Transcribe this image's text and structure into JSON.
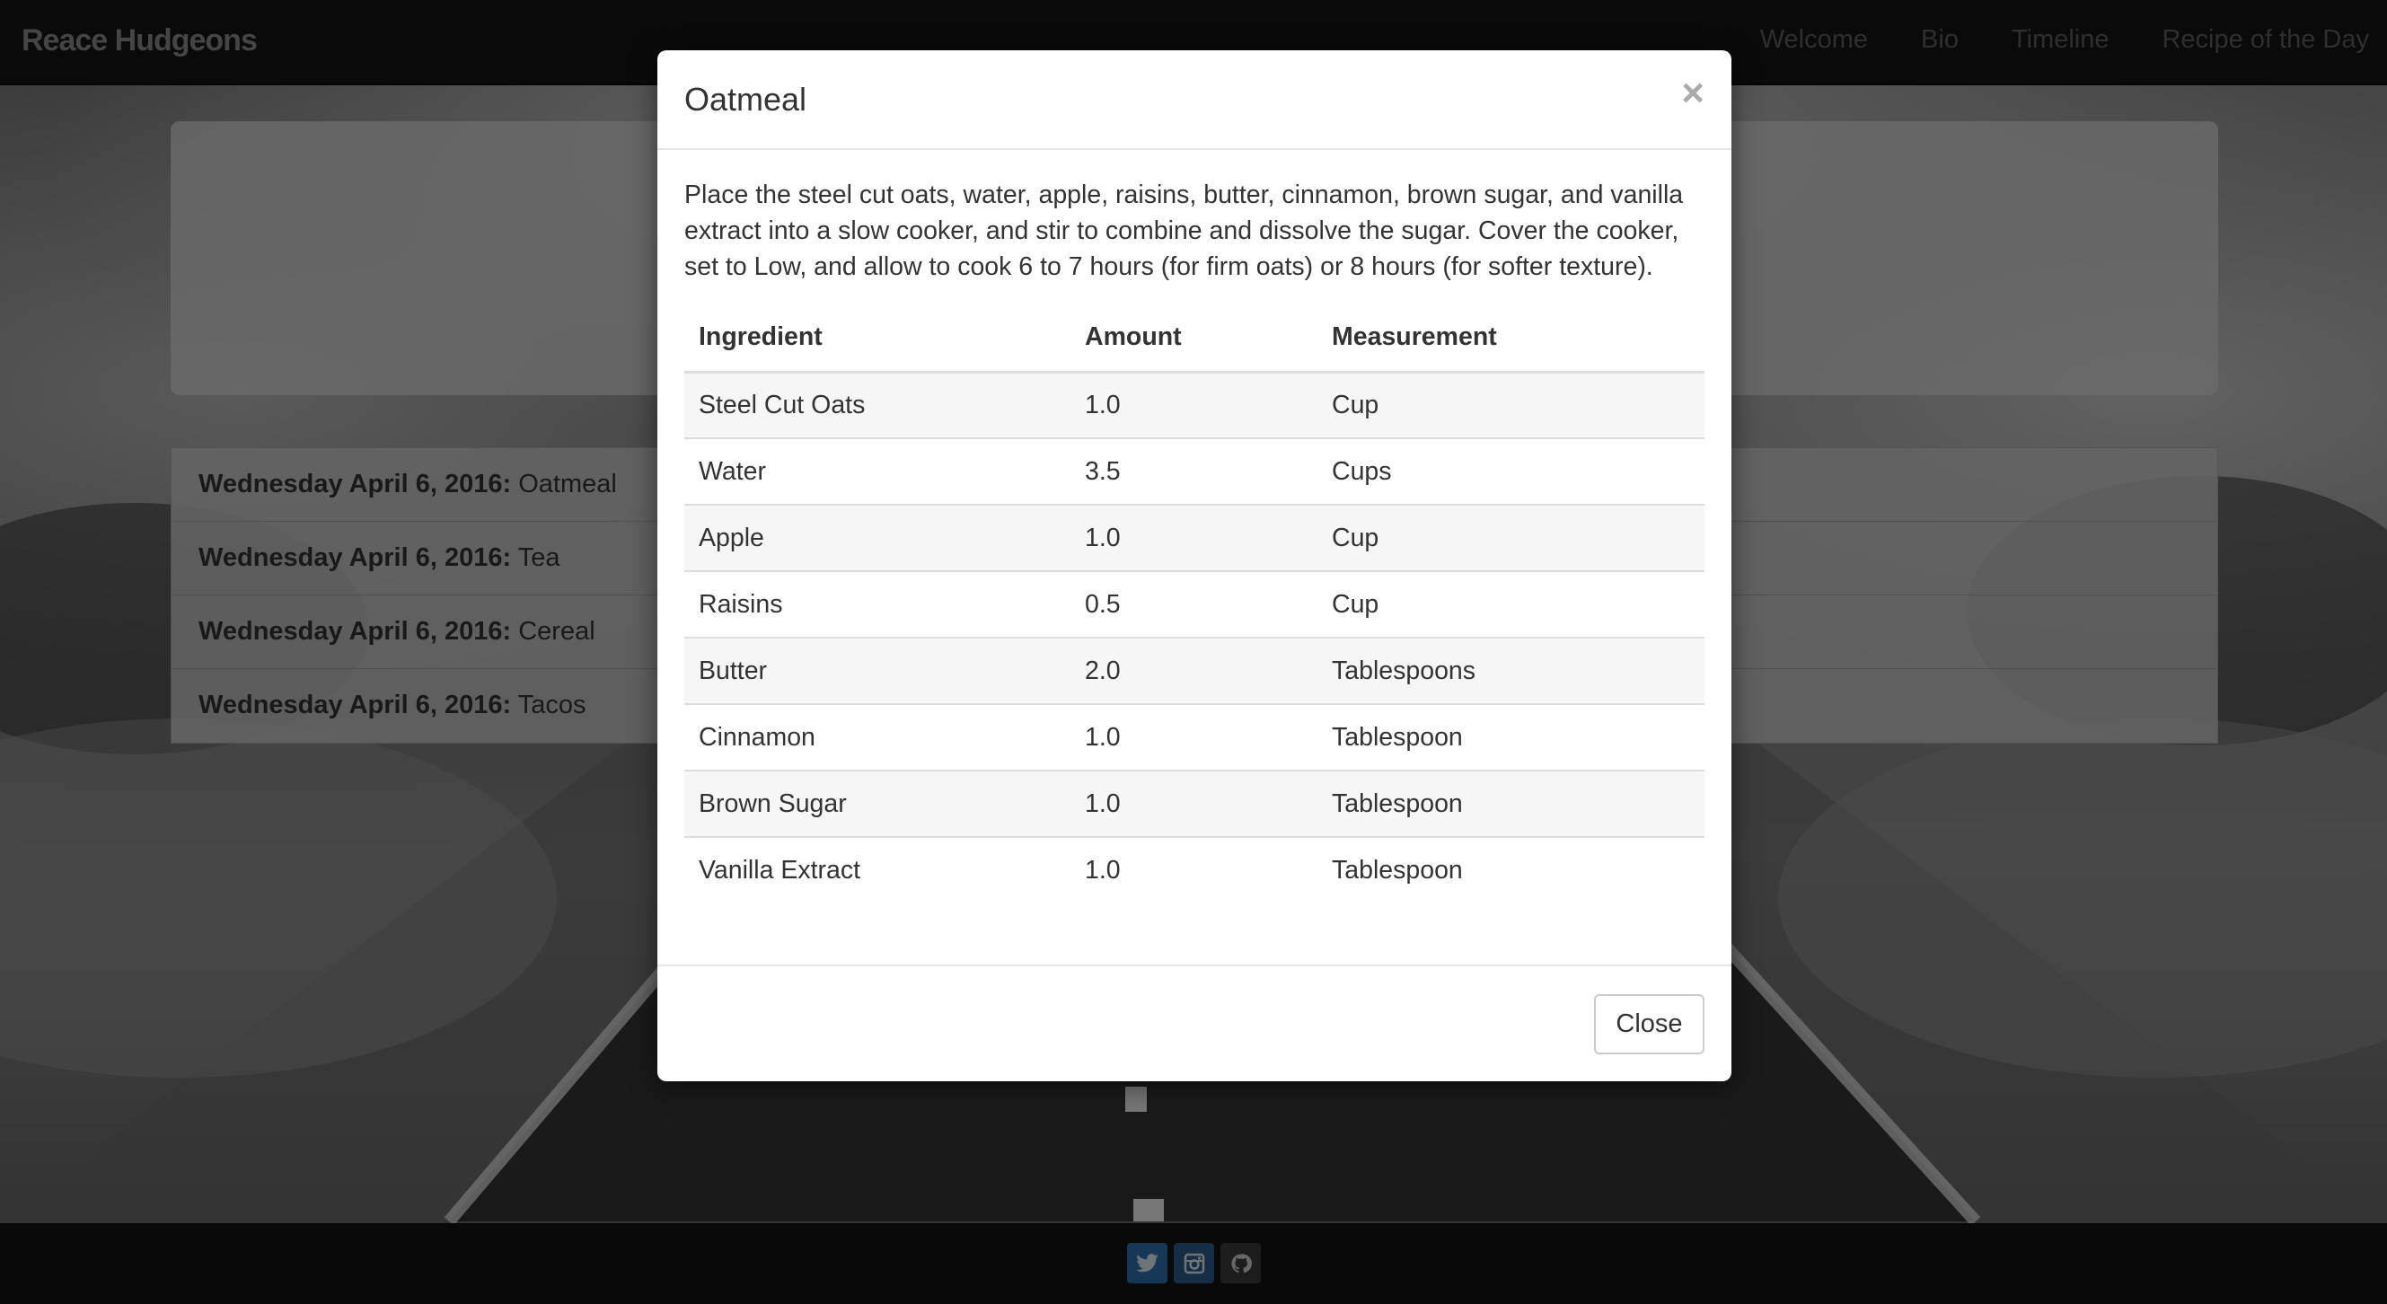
{
  "navbar": {
    "brand": "Reace Hudgeons",
    "links": [
      "Welcome",
      "Bio",
      "Timeline",
      "Recipe of the Day"
    ]
  },
  "timeline": [
    {
      "date": "Wednesday April 6, 2016:",
      "meal": "Oatmeal"
    },
    {
      "date": "Wednesday April 6, 2016:",
      "meal": "Tea"
    },
    {
      "date": "Wednesday April 6, 2016:",
      "meal": "Cereal"
    },
    {
      "date": "Wednesday April 6, 2016:",
      "meal": "Tacos"
    }
  ],
  "modal": {
    "title": "Oatmeal",
    "close_x": "×",
    "instructions": "Place the steel cut oats, water, apple, raisins, butter, cinnamon, brown sugar, and vanilla extract into a slow cooker, and stir to combine and dissolve the sugar. Cover the cooker, set to Low, and allow to cook 6 to 7 hours (for firm oats) or 8 hours (for softer texture).",
    "table": {
      "headers": [
        "Ingredient",
        "Amount",
        "Measurement"
      ],
      "rows": [
        [
          "Steel Cut Oats",
          "1.0",
          "Cup"
        ],
        [
          "Water",
          "3.5",
          "Cups"
        ],
        [
          "Apple",
          "1.0",
          "Cup"
        ],
        [
          "Raisins",
          "0.5",
          "Cup"
        ],
        [
          "Butter",
          "2.0",
          "Tablespoons"
        ],
        [
          "Cinnamon",
          "1.0",
          "Tablespoon"
        ],
        [
          "Brown Sugar",
          "1.0",
          "Tablespoon"
        ],
        [
          "Vanilla Extract",
          "1.0",
          "Tablespoon"
        ]
      ]
    },
    "close_label": "Close"
  },
  "footer": {
    "social_icons": [
      "twitter-icon",
      "instagram-icon",
      "github-icon"
    ]
  },
  "colors": {
    "navbar_bg": "#141414",
    "twitter": "#2c6fad",
    "instagram": "#2c5a8c",
    "github": "#3a3a3a"
  }
}
